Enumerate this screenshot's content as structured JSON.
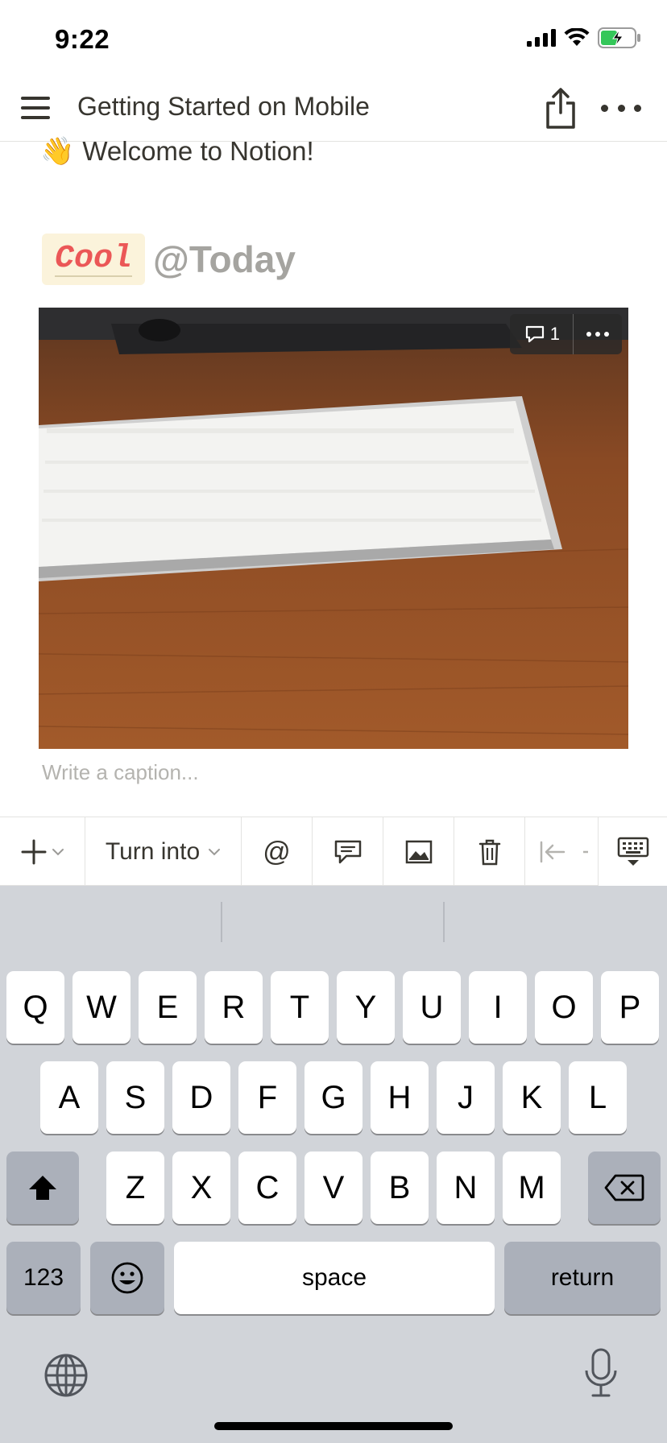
{
  "status": {
    "time": "9:22"
  },
  "nav": {
    "title": "Getting Started on Mobile"
  },
  "content": {
    "welcome_emoji": "👋",
    "welcome_text": "Welcome to Notion!",
    "cool_text": "Cool",
    "today_text": "@Today",
    "comment_count": "1",
    "caption_placeholder": "Write a caption..."
  },
  "toolbar": {
    "turn_into_label": "Turn into",
    "mention_symbol": "@"
  },
  "keyboard": {
    "row1": [
      "Q",
      "W",
      "E",
      "R",
      "T",
      "Y",
      "U",
      "I",
      "O",
      "P"
    ],
    "row2": [
      "A",
      "S",
      "D",
      "F",
      "G",
      "H",
      "J",
      "K",
      "L"
    ],
    "row3": [
      "Z",
      "X",
      "C",
      "V",
      "B",
      "N",
      "M"
    ],
    "numbers_label": "123",
    "space_label": "space",
    "return_label": "return"
  },
  "colors": {
    "cool_highlight_bg": "#fbf3db",
    "cool_text": "#eb5757",
    "keyboard_bg": "#d1d4d9"
  }
}
